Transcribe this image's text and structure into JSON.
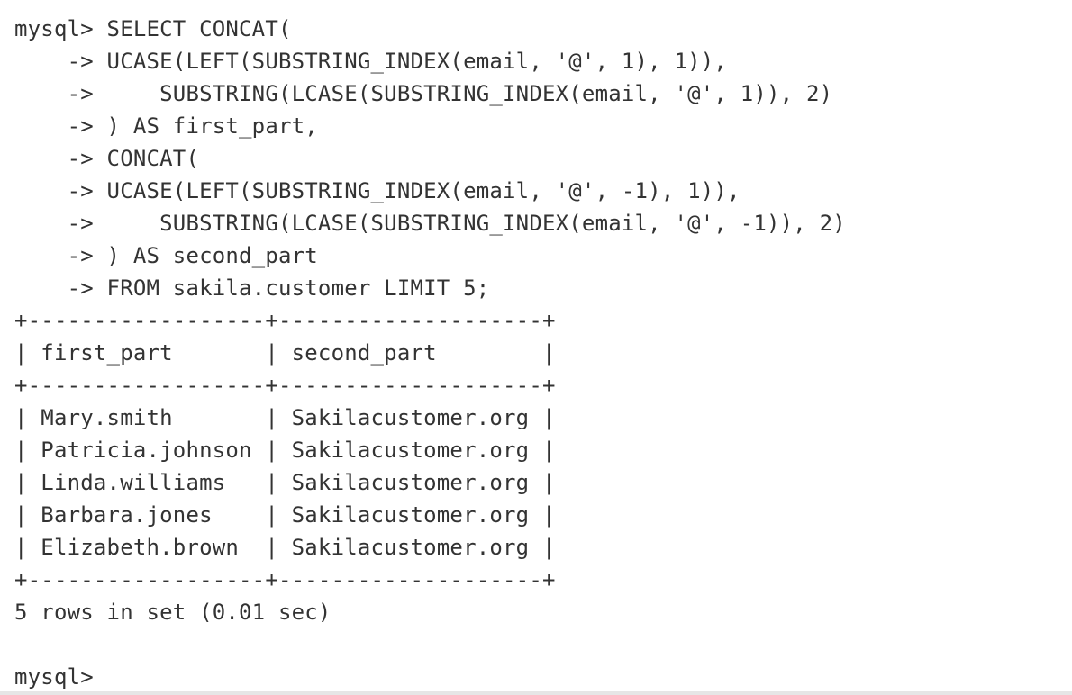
{
  "terminal": {
    "query": [
      "mysql> SELECT CONCAT(",
      "    -> UCASE(LEFT(SUBSTRING_INDEX(email, '@', 1), 1)),",
      "    ->     SUBSTRING(LCASE(SUBSTRING_INDEX(email, '@', 1)), 2)",
      "    -> ) AS first_part,",
      "    -> CONCAT(",
      "    -> UCASE(LEFT(SUBSTRING_INDEX(email, '@', -1), 1)),",
      "    ->     SUBSTRING(LCASE(SUBSTRING_INDEX(email, '@', -1)), 2)",
      "    -> ) AS second_part",
      "    -> FROM sakila.customer LIMIT 5;"
    ],
    "table": {
      "border": "+------------------+--------------------+",
      "header": "| first_part       | second_part        |",
      "rows": [
        "| Mary.smith       | Sakilacustomer.org |",
        "| Patricia.johnson | Sakilacustomer.org |",
        "| Linda.williams   | Sakilacustomer.org |",
        "| Barbara.jones    | Sakilacustomer.org |",
        "| Elizabeth.brown  | Sakilacustomer.org |"
      ]
    },
    "result_summary": "5 rows in set (0.01 sec)",
    "prompt": "mysql> "
  }
}
